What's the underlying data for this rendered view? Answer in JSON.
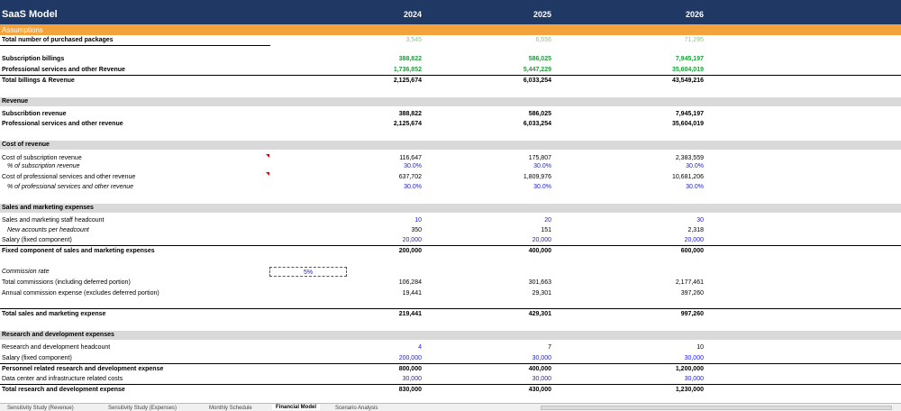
{
  "header": {
    "title": "SaaS Model",
    "years": [
      "2024",
      "2025",
      "2026"
    ]
  },
  "assumptions": {
    "title": "Assumptions",
    "total_packages": {
      "label": "Total number of purchased packages",
      "values": [
        "3,545",
        "6,556",
        "71,295"
      ]
    },
    "subscription_billings": {
      "label": "Subscription billings",
      "values": [
        "388,822",
        "586,025",
        "7,945,197"
      ]
    },
    "prof_services_revenue": {
      "label": "Professional services and other Revenue",
      "values": [
        "1,736,852",
        "5,447,229",
        "35,604,019"
      ]
    },
    "total_billings": {
      "label": "Total billings & Revenue",
      "values": [
        "2,125,674",
        "6,033,254",
        "43,549,216"
      ]
    }
  },
  "revenue": {
    "title": "Revenue",
    "subscription": {
      "label": "Subscribtion revenue",
      "values": [
        "388,822",
        "586,025",
        "7,945,197"
      ]
    },
    "prof_services": {
      "label": "Professional services and other revenue",
      "values": [
        "2,125,674",
        "6,033,254",
        "35,604,019"
      ]
    }
  },
  "cost_of_revenue": {
    "title": "Cost of revenue",
    "cost_subscription": {
      "label": "Cost of subscription revenue",
      "values": [
        "116,647",
        "175,807",
        "2,383,559"
      ]
    },
    "pct_subscription": {
      "label": "% of subscription revenue",
      "values": [
        "30.0%",
        "30.0%",
        "30.0%"
      ]
    },
    "cost_prof": {
      "label": "Cost of professional services and other revenue",
      "values": [
        "637,702",
        "1,809,976",
        "10,681,206"
      ]
    },
    "pct_prof": {
      "label": "% of professional services and other revenue",
      "values": [
        "30.0%",
        "30.0%",
        "30.0%"
      ]
    }
  },
  "sales_marketing": {
    "title": "Sales and marketing expenses",
    "headcount": {
      "label": "Sales and marketing staff headcount",
      "values": [
        "10",
        "20",
        "30"
      ]
    },
    "new_accounts": {
      "label": "New accounts per headcount",
      "values": [
        "350",
        "151",
        "2,318"
      ]
    },
    "salary": {
      "label": "Salary (fixed component)",
      "values": [
        "20,000",
        "20,000",
        "20,000"
      ]
    },
    "fixed_component": {
      "label": "Fixed component of sales and marketing expenses",
      "values": [
        "200,000",
        "400,000",
        "600,000"
      ]
    },
    "commission_rate": {
      "label": "Commission rate",
      "value": "5%"
    },
    "total_commissions": {
      "label": "Total commissions (including deferred portion)",
      "values": [
        "106,284",
        "301,663",
        "2,177,461"
      ]
    },
    "annual_commission": {
      "label": "Annual commission expense (excludes deferred portion)",
      "values": [
        "19,441",
        "29,301",
        "397,260"
      ]
    },
    "total": {
      "label": "Total sales and marketing expense",
      "values": [
        "219,441",
        "429,301",
        "997,260"
      ]
    }
  },
  "research_development": {
    "title": "Research and  development expenses",
    "headcount": {
      "label": "Research and development headcount",
      "values": [
        "4",
        "7",
        "10"
      ]
    },
    "salary": {
      "label": "Salary (fixed component)",
      "values": [
        "200,000",
        "30,000",
        "30,000"
      ]
    },
    "personnel": {
      "label": "Personnel related research and development expense",
      "values": [
        "800,000",
        "400,000",
        "1,200,000"
      ]
    },
    "data_center": {
      "label": "Data center and infrastructure related costs",
      "values": [
        "30,000",
        "30,000",
        "30,000"
      ]
    },
    "total": {
      "label": "Total research and development expense",
      "values": [
        "830,000",
        "430,000",
        "1,230,000"
      ]
    }
  },
  "sheet_tabs": [
    "Sensitivity Study (Revenue)",
    "Sensitivity Study (Expenses)",
    "Monthly Schedule",
    "Financial Model",
    "Scenario Analysis"
  ],
  "active_tab": "Financial Model"
}
